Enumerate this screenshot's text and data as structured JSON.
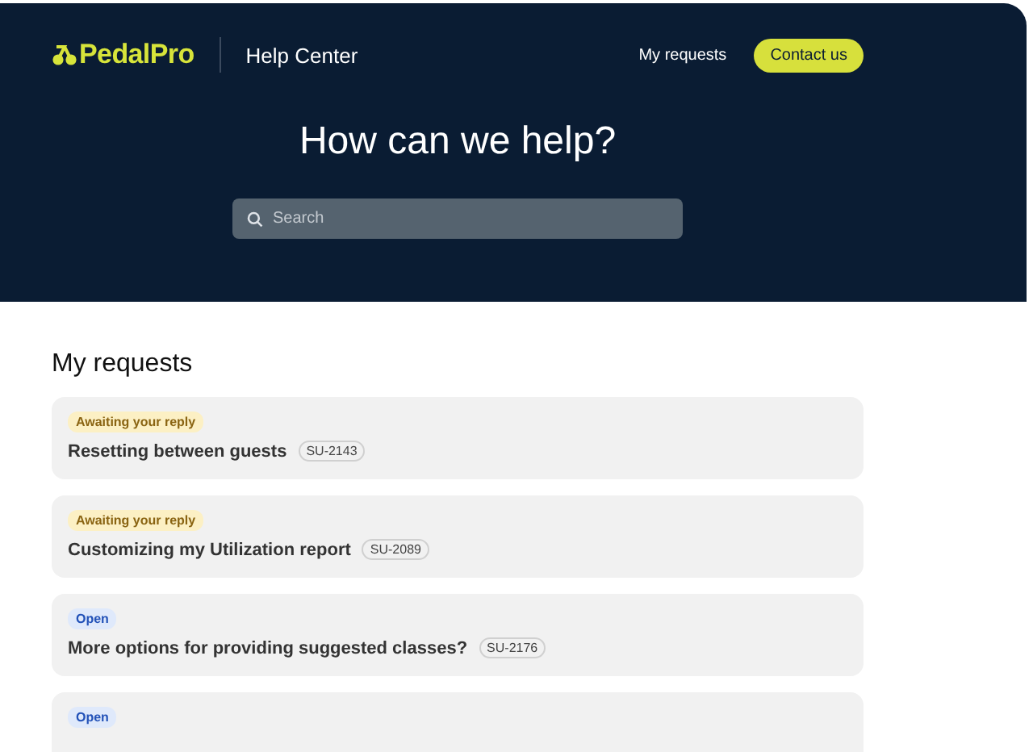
{
  "header": {
    "logo": "PedalPro",
    "section": "Help Center",
    "nav_link": "My requests",
    "contact_button": "Contact us"
  },
  "hero": {
    "title": "How can we help?",
    "search": {
      "placeholder": "Search"
    }
  },
  "requests": {
    "title": "My requests",
    "items": [
      {
        "status": "Awaiting your reply",
        "kind": "awaiting",
        "title": "Resetting between guests",
        "ticket": "SU-2143"
      },
      {
        "status": "Awaiting your reply",
        "kind": "awaiting",
        "title": "Customizing my Utilization report",
        "ticket": "SU-2089"
      },
      {
        "status": "Open",
        "kind": "open",
        "title": "More options for providing suggested classes?",
        "ticket": "SU-2176"
      },
      {
        "status": "Open",
        "kind": "open"
      }
    ]
  }
}
